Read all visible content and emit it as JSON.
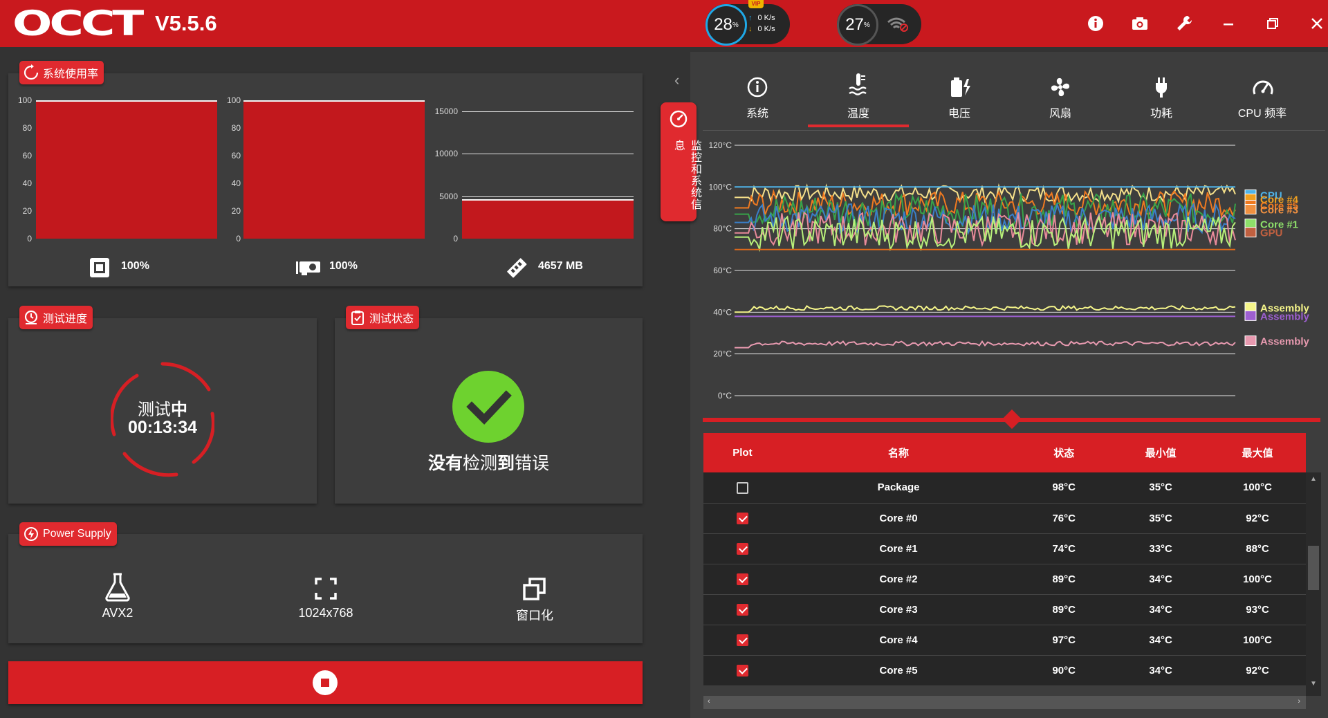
{
  "app": {
    "logo": "OCCT",
    "version": "V5.5.6",
    "cpu_load": "28",
    "gpu_load": "27",
    "percent_unit": "%",
    "net_up": "0 K/s",
    "net_down": "0 K/s",
    "vip_badge": "VIP"
  },
  "usage": {
    "title": "系统使用率",
    "cpu_ticks": [
      "100",
      "80",
      "60",
      "40",
      "20",
      "0"
    ],
    "gpu_ticks": [
      "100",
      "80",
      "60",
      "40",
      "20",
      "0"
    ],
    "mem_ticks": [
      "15000",
      "10000",
      "5000",
      "0"
    ],
    "cpu_value": "100%",
    "gpu_value": "100%",
    "mem_value": "4657 MB",
    "cpu_fraction": 1.0,
    "gpu_fraction": 1.0,
    "mem_mb": 4657
  },
  "progress": {
    "title": "测试进度",
    "status_prefix": "测试",
    "status_bold": "中",
    "elapsed": "00:13:34"
  },
  "state": {
    "title": "测试状态",
    "msg_1": "没有",
    "msg_2": "检测",
    "msg_3": "到",
    "msg_4": "错误"
  },
  "config": {
    "title": "Power Supply",
    "instr": "AVX2",
    "resolution": "1024x768",
    "window_mode": "窗口化"
  },
  "side_tab_label": "监控和系统信息",
  "tabs": [
    {
      "label": "系统"
    },
    {
      "label": "温度"
    },
    {
      "label": "电压"
    },
    {
      "label": "风扇"
    },
    {
      "label": "功耗"
    },
    {
      "label": "CPU 频率"
    }
  ],
  "chart_data": {
    "type": "line",
    "y_ticks": [
      "120°C",
      "100°C",
      "80°C",
      "60°C",
      "40°C",
      "20°C",
      "0°C"
    ],
    "ylim": [
      0,
      120
    ],
    "grid": true,
    "legend": [
      {
        "name": "CPU",
        "color": "#4fb3e8"
      },
      {
        "name": "Core #4",
        "color": "#f0a020"
      },
      {
        "name": "Core #5",
        "color": "#f07a20"
      },
      {
        "name": "Core #3",
        "color": "#f09040"
      },
      {
        "name": "Core #1",
        "color": "#8ee06a"
      },
      {
        "name": "GPU",
        "color": "#c06040"
      },
      {
        "name": "Assembly",
        "color": "#f5f58a"
      },
      {
        "name": "Assembly",
        "color": "#9d5fd0"
      },
      {
        "name": "Assembly",
        "color": "#e89ab0"
      }
    ],
    "series": [
      {
        "name": "Core #4",
        "color": "#f5e08a",
        "base": 97,
        "amp": 4
      },
      {
        "name": "Core #5",
        "color": "#f07a20",
        "base": 92,
        "amp": 6
      },
      {
        "name": "Core #2",
        "color": "#37a34a",
        "base": 89,
        "amp": 8
      },
      {
        "name": "Core #3",
        "color": "#3a7fc8",
        "base": 85,
        "amp": 7
      },
      {
        "name": "Core #0",
        "color": "#e88a9a",
        "base": 80,
        "amp": 8
      },
      {
        "name": "Core #1",
        "color": "#b8f07a",
        "base": 78,
        "amp": 8
      },
      {
        "name": "GPU",
        "color": "#e06a1a",
        "base": 70,
        "amp": 0
      },
      {
        "name": "CPU",
        "color": "#4fb3e8",
        "base": 100,
        "amp": 0
      },
      {
        "name": "Assembly",
        "color": "#f5f58a",
        "base": 42,
        "amp": 1
      },
      {
        "name": "Assembly",
        "color": "#9d5fd0",
        "base": 38,
        "amp": 0
      },
      {
        "name": "Assembly",
        "color": "#e89ab0",
        "base": 25,
        "amp": 1
      }
    ]
  },
  "table": {
    "headers": [
      "Plot",
      "名称",
      "状态",
      "最小值",
      "最大值"
    ],
    "rows": [
      {
        "checked": false,
        "name": "Package",
        "status": "98°C",
        "min": "35°C",
        "max": "100°C"
      },
      {
        "checked": true,
        "name": "Core #0",
        "status": "76°C",
        "min": "35°C",
        "max": "92°C"
      },
      {
        "checked": true,
        "name": "Core #1",
        "status": "74°C",
        "min": "33°C",
        "max": "88°C"
      },
      {
        "checked": true,
        "name": "Core #2",
        "status": "89°C",
        "min": "34°C",
        "max": "100°C"
      },
      {
        "checked": true,
        "name": "Core #3",
        "status": "89°C",
        "min": "34°C",
        "max": "93°C"
      },
      {
        "checked": true,
        "name": "Core #4",
        "status": "97°C",
        "min": "34°C",
        "max": "100°C"
      },
      {
        "checked": true,
        "name": "Core #5",
        "status": "90°C",
        "min": "34°C",
        "max": "92°C"
      }
    ]
  },
  "colors": {
    "accent": "#d71f24",
    "titlebar": "#c9191e",
    "panel": "#3d3d3d",
    "ok_green": "#6ed22f"
  }
}
